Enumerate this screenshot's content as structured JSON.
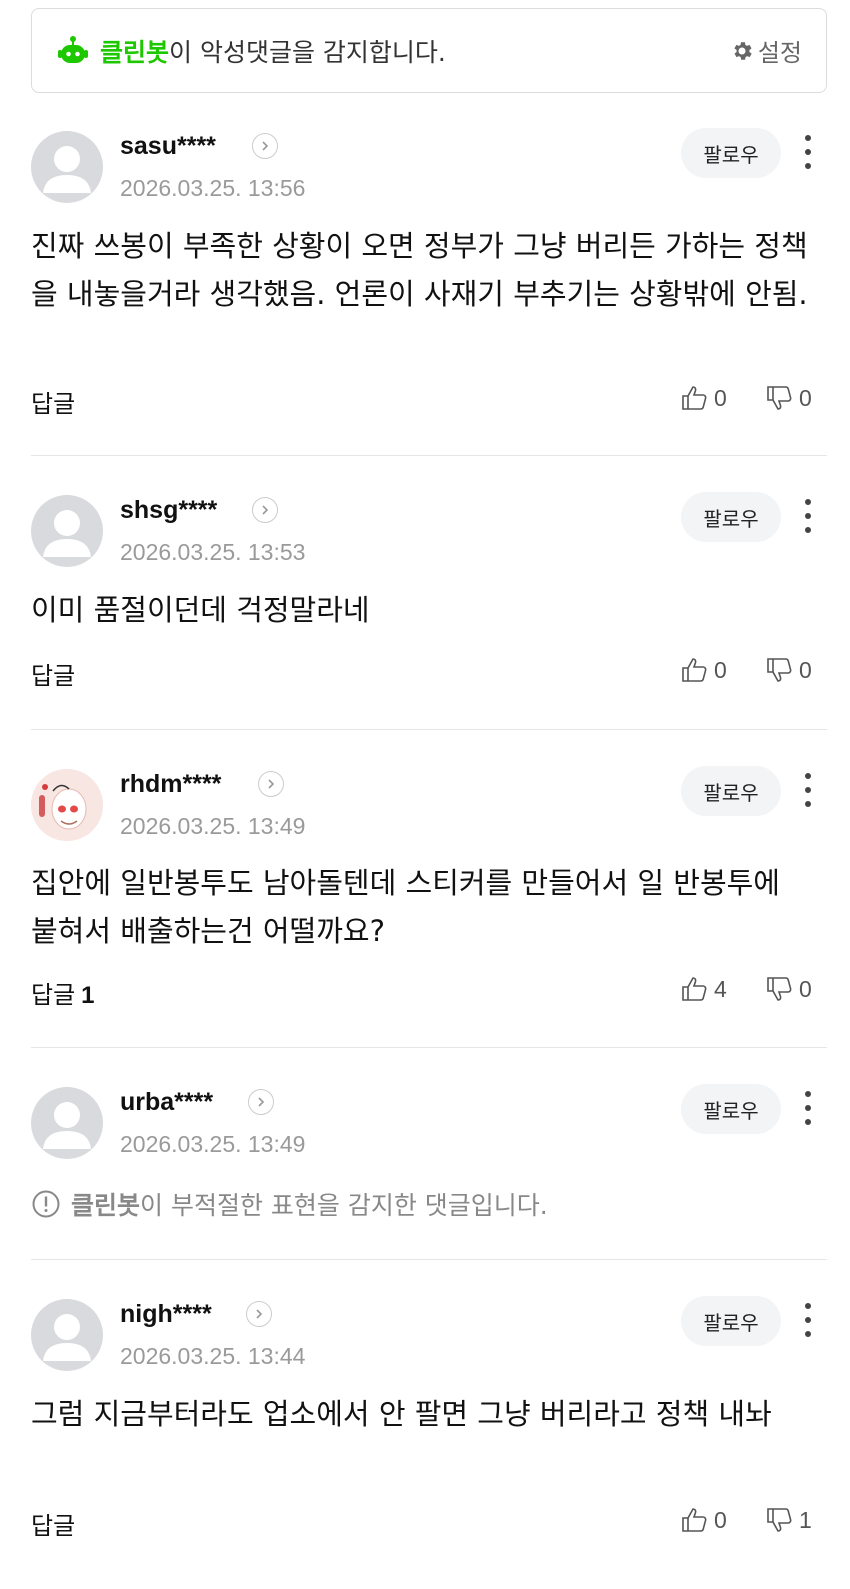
{
  "banner": {
    "bot_name": "클린봇",
    "message": "이 악성댓글을 감지합니다.",
    "settings_label": "설정"
  },
  "comments": [
    {
      "username": "sasu****",
      "timestamp": "2026.03.25. 13:56",
      "follow_label": "팔로우",
      "text": "진짜 쓰봉이 부족한 상황이 오면 정부가 그냥 버리든 가하는 정책을 내놓을거라 생각했음. 언론이 사재기 부추기는 상황밖에 안됨.",
      "reply_label": "답글",
      "reply_count": "",
      "likes": "0",
      "dislikes": "0"
    },
    {
      "username": "shsg****",
      "timestamp": "2026.03.25. 13:53",
      "follow_label": "팔로우",
      "text": "이미 품절이던데 걱정말라네",
      "reply_label": "답글",
      "reply_count": "",
      "likes": "0",
      "dislikes": "0"
    },
    {
      "username": "rhdm****",
      "timestamp": "2026.03.25. 13:49",
      "follow_label": "팔로우",
      "text": "집안에 일반봉투도 남아돌텐데 스티커를 만들어서 일 반봉투에 붙혀서 배출하는건 어떨까요?",
      "reply_label": "답글",
      "reply_count": "1",
      "likes": "4",
      "dislikes": "0"
    },
    {
      "username": "urba****",
      "timestamp": "2026.03.25. 13:49",
      "follow_label": "팔로우",
      "notice_bot": "클린봇",
      "notice_text": "이 부적절한 표현을 감지한 댓글입니다."
    },
    {
      "username": "nigh****",
      "timestamp": "2026.03.25. 13:44",
      "follow_label": "팔로우",
      "text": "그럼 지금부터라도 업소에서 안 팔면 그냥 버리라고 정책 내놔",
      "reply_label": "답글",
      "reply_count": "",
      "likes": "0",
      "dislikes": "1"
    }
  ]
}
